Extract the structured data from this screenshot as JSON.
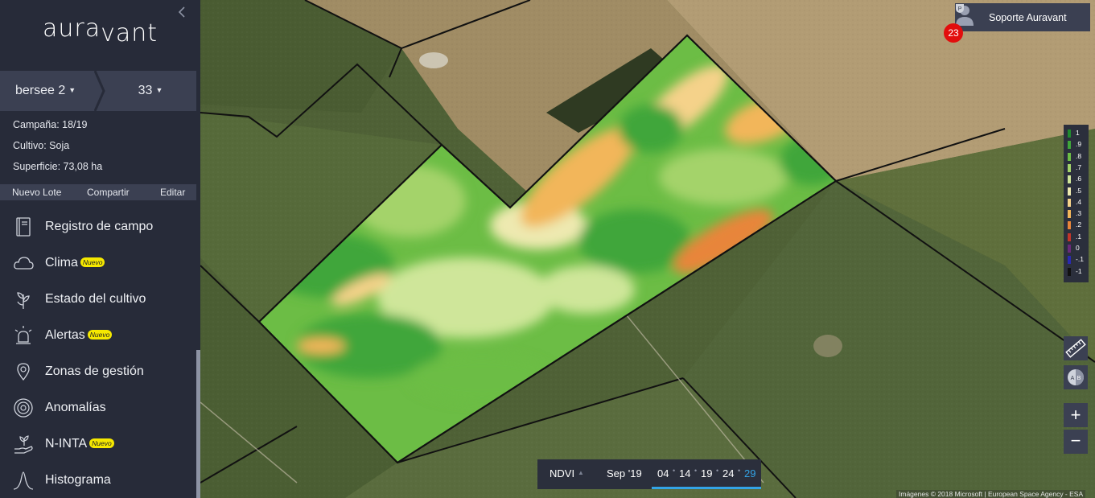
{
  "sidebar": {
    "logo": {
      "part1": "aura",
      "part2": "vant"
    },
    "selector": {
      "lot": "bersee 2",
      "number": "33"
    },
    "info": {
      "campaign": "Campaña: 18/19",
      "crop": "Cultivo: Soja",
      "area": "Superficie: 73,08 ha"
    },
    "actions": {
      "new_lot": "Nuevo Lote",
      "share": "Compartir",
      "edit": "Editar"
    },
    "menu": [
      {
        "label": "Registro de campo",
        "badge": "",
        "icon": "notebook-icon"
      },
      {
        "label": "Clima",
        "badge": "Nuevo",
        "icon": "cloud-icon"
      },
      {
        "label": "Estado del cultivo",
        "badge": "",
        "icon": "plant-icon"
      },
      {
        "label": "Alertas",
        "badge": "Nuevo",
        "icon": "alarm-light-icon"
      },
      {
        "label": "Zonas de gestión",
        "badge": "",
        "icon": "map-pin-icon"
      },
      {
        "label": "Anomalías",
        "badge": "",
        "icon": "radar-icon"
      },
      {
        "label": "N-INTA",
        "badge": "Nuevo",
        "icon": "hand-sprout-icon"
      },
      {
        "label": "Histograma",
        "badge": "",
        "icon": "bell-curve-icon"
      }
    ]
  },
  "user": {
    "name": "Soporte Auravant",
    "notifications": "23"
  },
  "legend": {
    "labels": [
      "1",
      ".9",
      ".8",
      ".7",
      ".6",
      ".5",
      ".4",
      ".3",
      ".2",
      ".1",
      "0",
      "-.1",
      "-1"
    ],
    "colors": [
      "#1f8a2e",
      "#3fa63a",
      "#6cbd45",
      "#a4d36a",
      "#cfe69a",
      "#eee9b0",
      "#f5d28a",
      "#f2b65a",
      "#e8853a",
      "#c2352a",
      "#6a2a7a",
      "#2a2ab0",
      "#111111"
    ]
  },
  "controls": {
    "zoom_in": "+",
    "zoom_out": "−"
  },
  "timebar": {
    "index": "NDVI",
    "month": "Sep '19",
    "days": [
      "04",
      "14",
      "19",
      "24",
      "29"
    ]
  },
  "attribution": "Imágenes © 2018 Microsoft | European Space Agency - ESA"
}
